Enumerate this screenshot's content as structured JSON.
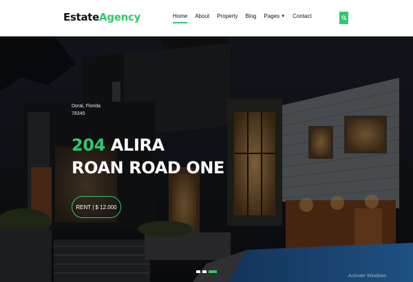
{
  "brand": {
    "part1": "Estate",
    "part2": "Agency"
  },
  "nav": {
    "items": [
      {
        "label": "Home",
        "active": true
      },
      {
        "label": "About"
      },
      {
        "label": "Property"
      },
      {
        "label": "Blog"
      },
      {
        "label": "Pages",
        "dropdown": true
      },
      {
        "label": "Contact"
      }
    ],
    "search_icon": "search-icon"
  },
  "hero": {
    "location_line1": "Doral, Florida",
    "location_line2": "78345",
    "title_number": "204",
    "title_rest_line1": "ALIRA",
    "title_line2": "ROAN ROAD ONE",
    "rent_label": "RENT | $ 12.000",
    "carousel": {
      "count": 3,
      "active_index": 2
    }
  },
  "watermark": "Activate Windows",
  "colors": {
    "accent": "#2eca6a",
    "text_dark": "#111111",
    "white": "#ffffff"
  }
}
